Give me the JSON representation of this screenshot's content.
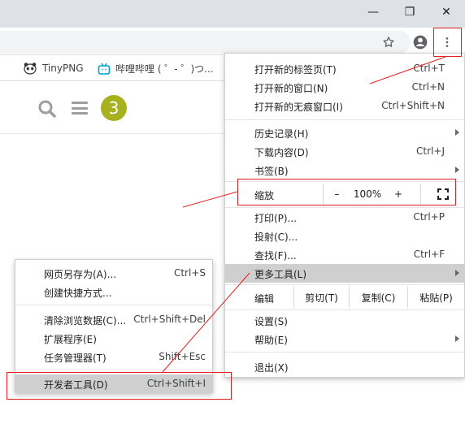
{
  "window": {
    "minimize_label": "—",
    "restore_label": "❐",
    "close_label": "✕"
  },
  "toolbar": {
    "star_icon": "star-icon",
    "profile_icon": "account-circle-icon",
    "menu_icon": "more-vertical-icon"
  },
  "bookmarks": [
    {
      "label": "TinyPNG",
      "icon": "panda-icon"
    },
    {
      "label": "哔哩哔哩 ( ゜- ゜)つ...",
      "icon": "bilibili-tv-icon"
    }
  ],
  "page": {
    "badge_text": "3",
    "search_icon": "search-icon",
    "menu_icon": "hamburger-icon"
  },
  "menu": {
    "new_tab": {
      "label": "打开新的标签页(T)",
      "shortcut": "Ctrl+T"
    },
    "new_window": {
      "label": "打开新的窗口(N)",
      "shortcut": "Ctrl+N"
    },
    "incognito": {
      "label": "打开新的无痕窗口(I)",
      "shortcut": "Ctrl+Shift+N"
    },
    "history": {
      "label": "历史记录(H)"
    },
    "downloads": {
      "label": "下载内容(D)",
      "shortcut": "Ctrl+J"
    },
    "bookmarks": {
      "label": "书签(B)"
    },
    "zoom": {
      "label": "缩放",
      "minus": "–",
      "value": "100%",
      "plus": "+"
    },
    "print": {
      "label": "打印(P)...",
      "shortcut": "Ctrl+P"
    },
    "cast": {
      "label": "投射(C)..."
    },
    "find": {
      "label": "查找(F)...",
      "shortcut": "Ctrl+F"
    },
    "more_tools": {
      "label": "更多工具(L)"
    },
    "edit": {
      "label": "编辑",
      "cut": "剪切(T)",
      "copy": "复制(C)",
      "paste": "粘贴(P)"
    },
    "settings": {
      "label": "设置(S)"
    },
    "help": {
      "label": "帮助(E)"
    },
    "exit": {
      "label": "退出(X)"
    }
  },
  "submenu": {
    "save_page": {
      "label": "网页另存为(A)...",
      "shortcut": "Ctrl+S"
    },
    "create_shortcut": {
      "label": "创建快捷方式..."
    },
    "clear_data": {
      "label": "清除浏览数据(C)...",
      "shortcut": "Ctrl+Shift+Del"
    },
    "extensions": {
      "label": "扩展程序(E)"
    },
    "task_manager": {
      "label": "任务管理器(T)",
      "shortcut": "Shift+Esc"
    },
    "dev_tools": {
      "label": "开发者工具(D)",
      "shortcut": "Ctrl+Shift+I"
    }
  },
  "colors": {
    "annotation": "#e02020",
    "badge": "#a7b01f",
    "highlight": "#cfcfcf"
  }
}
